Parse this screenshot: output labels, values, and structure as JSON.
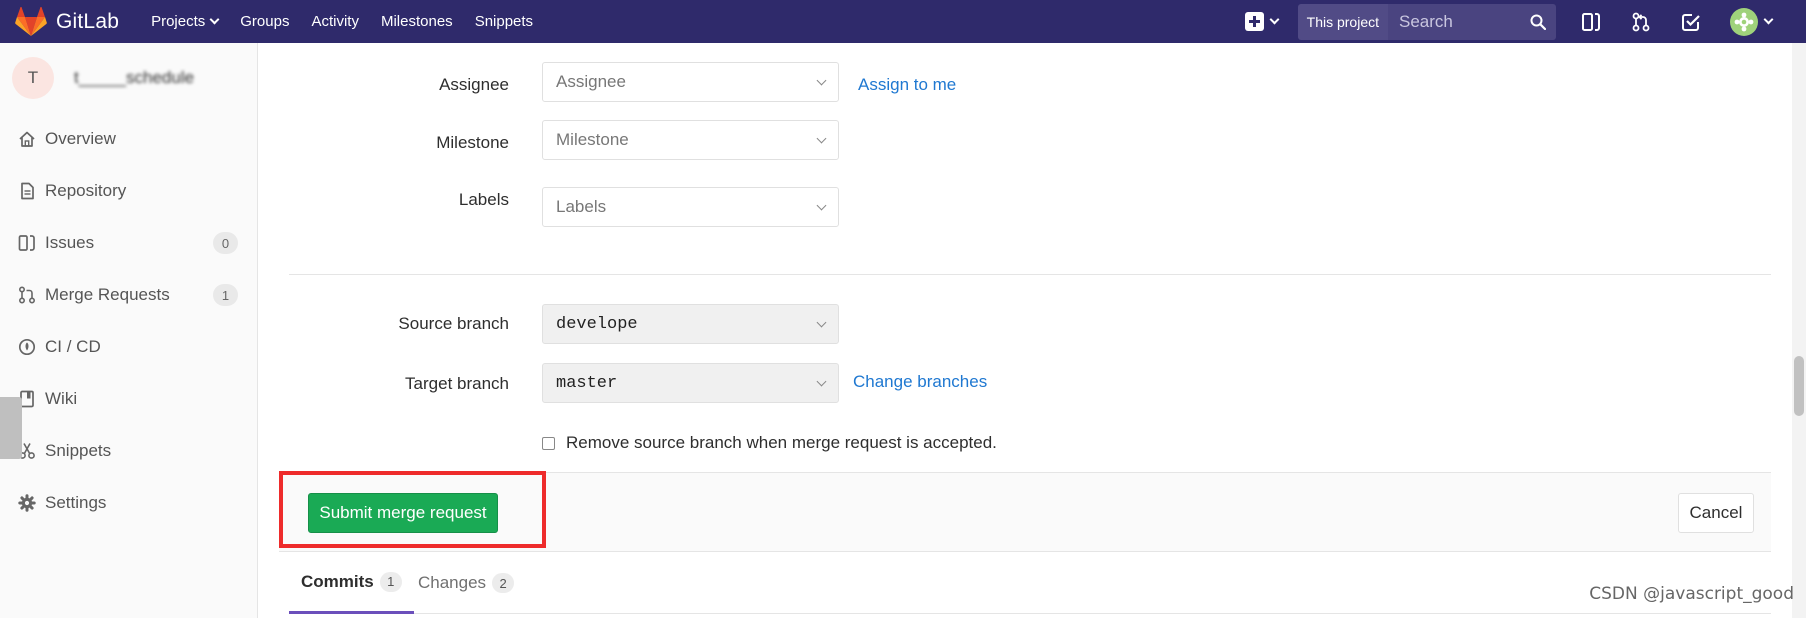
{
  "navbar": {
    "brand": "GitLab",
    "links": [
      "Projects",
      "Groups",
      "Activity",
      "Milestones",
      "Snippets"
    ],
    "scope": "This project",
    "search_placeholder": "Search"
  },
  "sidebar": {
    "project_initial": "T",
    "project_name": "t_____schedule",
    "items": [
      {
        "label": "Overview",
        "icon": "home-icon"
      },
      {
        "label": "Repository",
        "icon": "document-icon"
      },
      {
        "label": "Issues",
        "icon": "issues-icon",
        "count": "0"
      },
      {
        "label": "Merge Requests",
        "icon": "merge-request-icon",
        "count": "1"
      },
      {
        "label": "CI / CD",
        "icon": "rocket-icon"
      },
      {
        "label": "Wiki",
        "icon": "book-icon"
      },
      {
        "label": "Snippets",
        "icon": "scissors-icon"
      },
      {
        "label": "Settings",
        "icon": "gear-icon"
      }
    ]
  },
  "form": {
    "assignee": {
      "label": "Assignee",
      "value": "Assignee",
      "link": "Assign to me"
    },
    "milestone": {
      "label": "Milestone",
      "value": "Milestone"
    },
    "labels": {
      "label": "Labels",
      "value": "Labels"
    },
    "source_branch": {
      "label": "Source branch",
      "value": "develope"
    },
    "target_branch": {
      "label": "Target branch",
      "value": "master",
      "link": "Change branches"
    },
    "remove_source": "Remove source branch when merge request is accepted."
  },
  "actions": {
    "submit": "Submit merge request",
    "cancel": "Cancel"
  },
  "tabs": [
    {
      "label": "Commits",
      "count": "1",
      "active": true
    },
    {
      "label": "Changes",
      "count": "2",
      "active": false
    }
  ],
  "watermark": "CSDN @javascript_good",
  "colors": {
    "navbar": "#2f2a6b",
    "submit": "#1aaa55",
    "link": "#1f78d1",
    "highlight": "#ee2b2b"
  }
}
